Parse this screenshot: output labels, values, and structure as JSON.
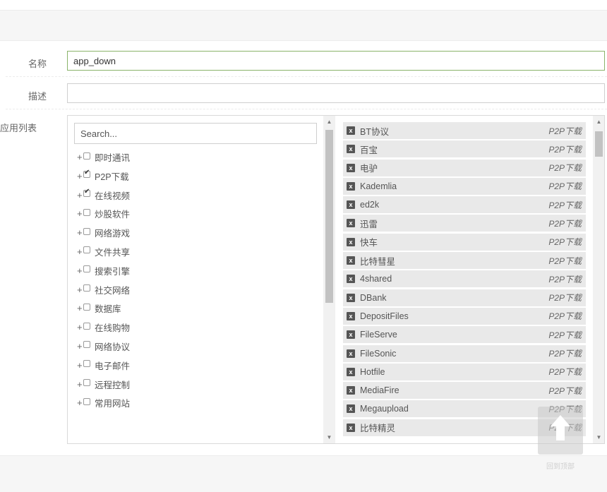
{
  "form": {
    "name_label": "名称",
    "name_value": "app_down",
    "desc_label": "描述",
    "desc_value": "",
    "list_label": "应用列表"
  },
  "search": {
    "placeholder": "Search..."
  },
  "categories": [
    {
      "label": "即时通讯",
      "checked": false
    },
    {
      "label": "P2P下载",
      "checked": true
    },
    {
      "label": "在线视频",
      "checked": true
    },
    {
      "label": "炒股软件",
      "checked": false
    },
    {
      "label": "网络游戏",
      "checked": false
    },
    {
      "label": "文件共享",
      "checked": false
    },
    {
      "label": "搜索引擎",
      "checked": false
    },
    {
      "label": "社交网络",
      "checked": false
    },
    {
      "label": "数据库",
      "checked": false
    },
    {
      "label": "在线购物",
      "checked": false
    },
    {
      "label": "网络协议",
      "checked": false
    },
    {
      "label": "电子邮件",
      "checked": false
    },
    {
      "label": "远程控制",
      "checked": false
    },
    {
      "label": "常用网站",
      "checked": false
    }
  ],
  "selected_apps": [
    {
      "name": "BT协议",
      "category": "P2P下载"
    },
    {
      "name": "百宝",
      "category": "P2P下载"
    },
    {
      "name": "电驴",
      "category": "P2P下载"
    },
    {
      "name": "Kademlia",
      "category": "P2P下载"
    },
    {
      "name": "ed2k",
      "category": "P2P下载"
    },
    {
      "name": "迅雷",
      "category": "P2P下载"
    },
    {
      "name": "快车",
      "category": "P2P下载"
    },
    {
      "name": "比特彗星",
      "category": "P2P下载"
    },
    {
      "name": "4shared",
      "category": "P2P下载"
    },
    {
      "name": "DBank",
      "category": "P2P下载"
    },
    {
      "name": "DepositFiles",
      "category": "P2P下载"
    },
    {
      "name": "FileServe",
      "category": "P2P下载"
    },
    {
      "name": "FileSonic",
      "category": "P2P下载"
    },
    {
      "name": "Hotfile",
      "category": "P2P下载"
    },
    {
      "name": "MediaFire",
      "category": "P2P下载"
    },
    {
      "name": "Megaupload",
      "category": "P2P下载"
    },
    {
      "name": "比特精灵",
      "category": "P2P下载"
    }
  ],
  "remove_badge": "x",
  "back_to_top": {
    "label": "回到顶部"
  }
}
